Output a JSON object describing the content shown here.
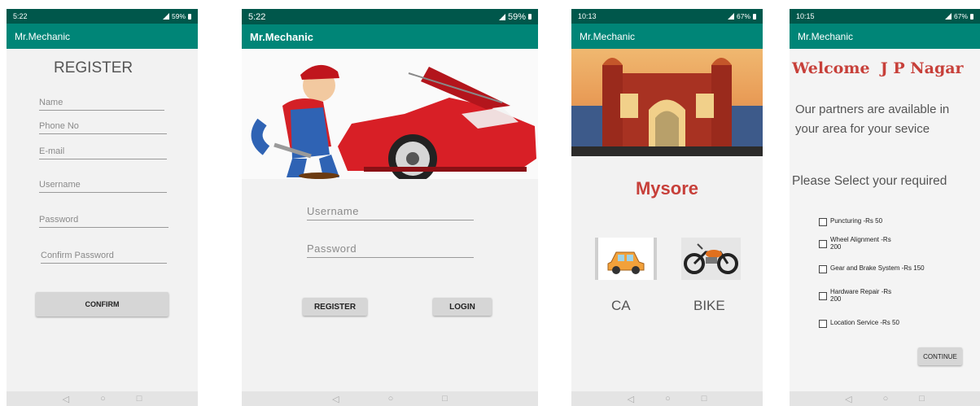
{
  "app_title": "Mr.Mechanic",
  "nav": {
    "back": "◁",
    "home": "○",
    "recents": "□"
  },
  "screen1": {
    "status": {
      "time": "5:22",
      "battery": "59%"
    },
    "title": "REGISTER",
    "fields": [
      "Name",
      "Phone No",
      "E-mail",
      "Username",
      "Password",
      "Confirm Password"
    ],
    "confirm_label": "CONFIRM"
  },
  "screen2": {
    "status": {
      "time": "5:22",
      "battery": "59%"
    },
    "username_placeholder": "Username",
    "password_placeholder": "Password",
    "register_label": "REGISTER",
    "login_label": "LOGIN"
  },
  "screen3": {
    "status": {
      "time": "10:13",
      "battery": "67%"
    },
    "city": "Mysore",
    "car_label": "CA",
    "bike_label": "BIKE"
  },
  "screen4": {
    "status": {
      "time": "10:15",
      "battery": "67%"
    },
    "welcome": "Welcome  J P Nagar",
    "partners_line1": "Our partners are available in",
    "partners_line2": "your area for your sevice",
    "select_heading": "Please Select your required",
    "services": [
      {
        "l1": "Puncturing  -Rs 50",
        "l2": ""
      },
      {
        "l1": "Wheel Alignment -Rs",
        "l2": "200"
      },
      {
        "l1": "Gear and Brake System -Rs 150",
        "l2": ""
      },
      {
        "l1": "Hardware Repair  -Rs",
        "l2": "200"
      },
      {
        "l1": "Location Service  -Rs 50",
        "l2": ""
      }
    ],
    "continue_label": "CONTINUE"
  },
  "colors": {
    "status_bar": "#00574b",
    "app_bar": "#008577",
    "accent_red": "#c0392b"
  }
}
